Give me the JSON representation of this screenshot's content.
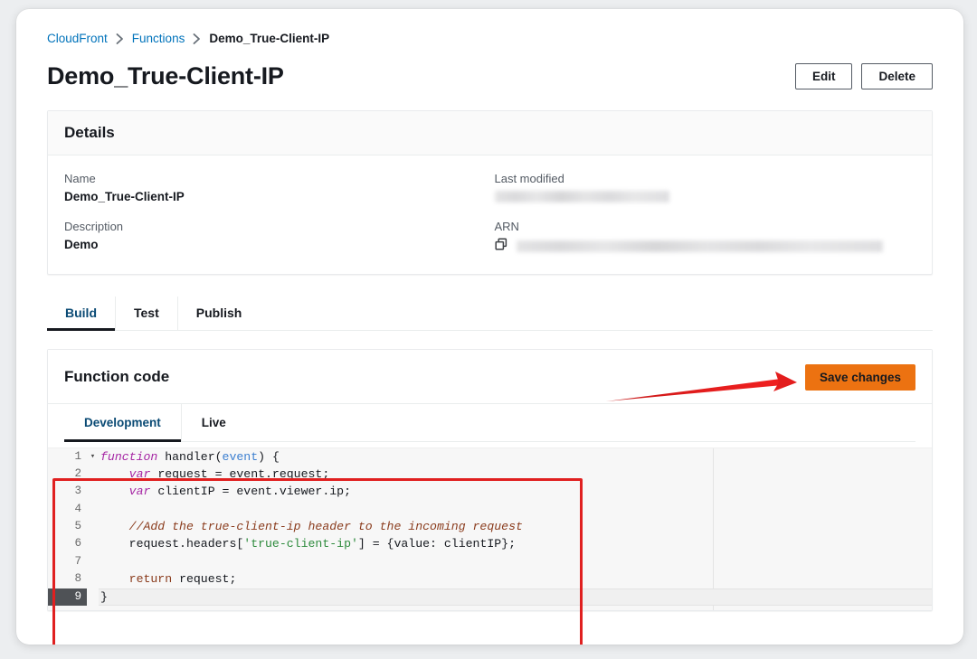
{
  "breadcrumb": {
    "items": [
      {
        "label": "CloudFront",
        "current": false
      },
      {
        "label": "Functions",
        "current": false
      },
      {
        "label": "Demo_True-Client-IP",
        "current": true
      }
    ]
  },
  "header": {
    "title": "Demo_True-Client-IP",
    "edit_label": "Edit",
    "delete_label": "Delete"
  },
  "details": {
    "panel_title": "Details",
    "name_label": "Name",
    "name_value": "Demo_True-Client-IP",
    "description_label": "Description",
    "description_value": "Demo",
    "last_modified_label": "Last modified",
    "last_modified_value": "",
    "arn_label": "ARN",
    "arn_value": "",
    "copy_icon": "copy-icon"
  },
  "tabs": [
    {
      "label": "Build",
      "active": true
    },
    {
      "label": "Test",
      "active": false
    },
    {
      "label": "Publish",
      "active": false
    }
  ],
  "function_code": {
    "panel_title": "Function code",
    "save_label": "Save changes",
    "subtabs": [
      {
        "label": "Development",
        "active": true
      },
      {
        "label": "Live",
        "active": false
      }
    ]
  },
  "editor": {
    "active_line": 9,
    "lines": [
      {
        "n": "1",
        "fold": "▾",
        "tokens": [
          {
            "t": "function ",
            "c": "tok-kw"
          },
          {
            "t": "handler(",
            "c": "tok-plain"
          },
          {
            "t": "event",
            "c": "tok-param"
          },
          {
            "t": ") {",
            "c": "tok-plain"
          }
        ]
      },
      {
        "n": "2",
        "fold": "",
        "tokens": [
          {
            "t": "    ",
            "c": "tok-plain"
          },
          {
            "t": "var ",
            "c": "tok-kw"
          },
          {
            "t": "request = event.request;",
            "c": "tok-plain"
          }
        ]
      },
      {
        "n": "3",
        "fold": "",
        "tokens": [
          {
            "t": "    ",
            "c": "tok-plain"
          },
          {
            "t": "var ",
            "c": "tok-kw"
          },
          {
            "t": "clientIP = event.viewer.ip;",
            "c": "tok-plain"
          }
        ]
      },
      {
        "n": "4",
        "fold": "",
        "tokens": [
          {
            "t": "",
            "c": "tok-plain"
          }
        ]
      },
      {
        "n": "5",
        "fold": "",
        "tokens": [
          {
            "t": "    ",
            "c": "tok-plain"
          },
          {
            "t": "//Add the true-client-ip header to the incoming request",
            "c": "tok-comment"
          }
        ]
      },
      {
        "n": "6",
        "fold": "",
        "tokens": [
          {
            "t": "    request.headers[",
            "c": "tok-plain"
          },
          {
            "t": "'true-client-ip'",
            "c": "tok-str"
          },
          {
            "t": "] = {value: clientIP};",
            "c": "tok-plain"
          }
        ]
      },
      {
        "n": "7",
        "fold": "",
        "tokens": [
          {
            "t": "",
            "c": "tok-plain"
          }
        ]
      },
      {
        "n": "8",
        "fold": "",
        "tokens": [
          {
            "t": "    ",
            "c": "tok-plain"
          },
          {
            "t": "return ",
            "c": "tok-kw2"
          },
          {
            "t": "request;",
            "c": "tok-plain"
          }
        ]
      },
      {
        "n": "9",
        "fold": "",
        "tokens": [
          {
            "t": "}",
            "c": "tok-plain"
          }
        ]
      }
    ]
  },
  "annotations": {
    "color": "#e02020",
    "code_highlight_rect": true,
    "save_arrow": true
  }
}
